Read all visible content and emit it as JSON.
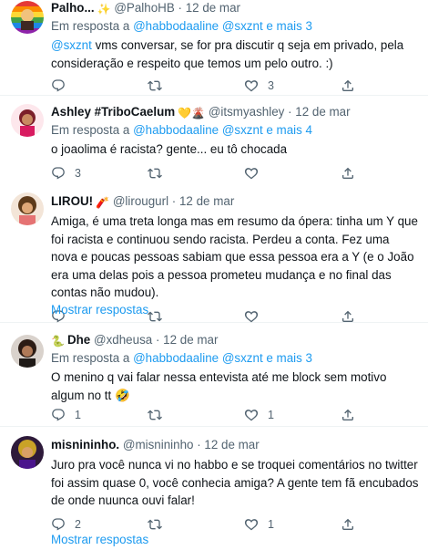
{
  "reply_prefix": "Em resposta a",
  "show_replies": "Mostrar respostas",
  "tweets": [
    {
      "name": "Palho...",
      "name_emoji": "✨",
      "handle": "@PalhoHB",
      "time": "12 de mar",
      "reply_to": "@habbodaaline @sxznt e mais 3",
      "mention": "@sxznt",
      "text": " vms conversar, se for pra discutir q seja em privado, pela consideração e respeito que temos um pelo outro. :)",
      "replies": "",
      "retweets": "",
      "likes": "3"
    },
    {
      "name": "Ashley #TriboCaelum",
      "name_emoji": "💛🌋",
      "handle": "@itsmyashley",
      "time": "12 de mar",
      "reply_to": "@habbodaaline @sxznt e mais 4",
      "text": "o joaolima é racista? gente... eu tô chocada",
      "replies": "3",
      "retweets": "",
      "likes": ""
    },
    {
      "name": "LIROU!",
      "name_emoji": "🧨",
      "handle": "@lirougurl",
      "time": "12 de mar",
      "text": "Amiga, é uma treta longa mas em resumo da ópera: tinha um Y que foi racista e continuou sendo racista. Perdeu a conta. Fez uma nova e poucas pessoas sabiam que essa pessoa era a Y (e o João era uma delas pois a pessoa prometeu mudança e no final das contas não mudou).",
      "replies": "",
      "retweets": "",
      "likes": ""
    },
    {
      "name": "Dhe",
      "name_emoji": "🐍",
      "handle": "@xdheusa",
      "time": "12 de mar",
      "reply_to": "@habbodaaline @sxznt e mais 3",
      "text": "O menino q vai falar nessa entevista até me block sem motivo algum no tt 🤣",
      "replies": "1",
      "retweets": "",
      "likes": "1"
    },
    {
      "name": "misnininho.",
      "name_emoji": "",
      "handle": "@misnininho",
      "time": "12 de mar",
      "text": "Juro pra você nunca vi no habbo e se troquei comentários no twitter foi assim quase 0, você conhecia amiga? A gente tem fã encubados de onde nuunca ouvi falar!",
      "replies": "2",
      "retweets": "",
      "likes": "1"
    }
  ],
  "colors": {
    "accent": "#1d9bf0",
    "muted": "#536471",
    "border": "#eff3f4"
  }
}
